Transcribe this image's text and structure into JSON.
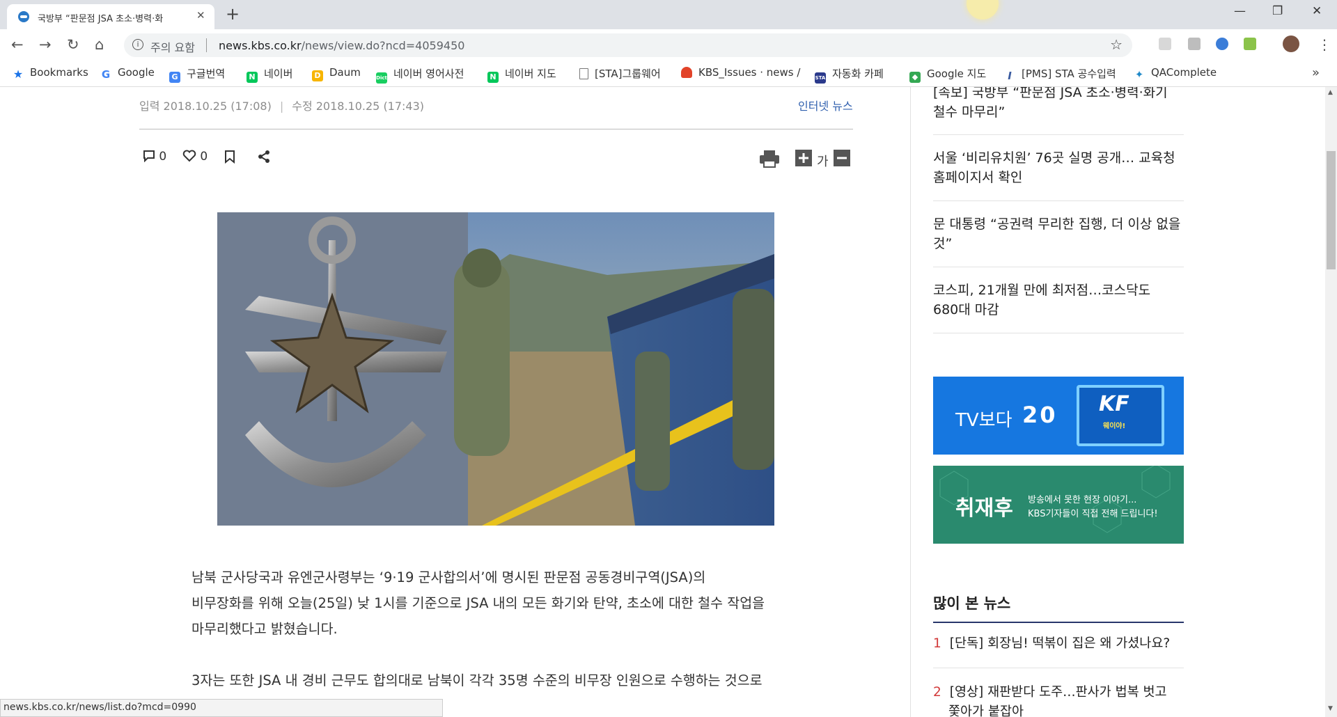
{
  "browser": {
    "tab_title": "국방부 “판문점 JSA 초소·병력·화",
    "new_tab": "+",
    "window_minimize": "—",
    "window_restore": "❐",
    "window_close": "✕",
    "security_warning": "주의 요함",
    "url_host": "news.kbs.co.kr",
    "url_path": "/news/view.do?ncd=4059450"
  },
  "bookmarks": [
    {
      "label": "Bookmarks",
      "icon": "star-icon",
      "color": "#1a73e8"
    },
    {
      "label": "Google",
      "icon": "google-icon",
      "color": "#4285f4"
    },
    {
      "label": "구글번역",
      "icon": "translate-icon",
      "color": "#4285f4"
    },
    {
      "label": "네이버",
      "icon": "naver-icon",
      "color": "#03c75a"
    },
    {
      "label": "Daum",
      "icon": "daum-icon",
      "color": "#f7b500"
    },
    {
      "label": "네이버 영어사전",
      "icon": "dict-icon",
      "color": "#19ce60"
    },
    {
      "label": "네이버 지도",
      "icon": "naver-icon",
      "color": "#03c75a"
    },
    {
      "label": "[STA]그룹웨어",
      "icon": "page-icon",
      "color": "#888888"
    },
    {
      "label": "KBS_Issues · news /",
      "icon": "gitlab-icon",
      "color": "#e24329"
    },
    {
      "label": "자동화 카페",
      "icon": "cafe-icon",
      "color": "#2b3a8c"
    },
    {
      "label": "Google 지도",
      "icon": "maps-icon",
      "color": "#34a853"
    },
    {
      "label": "[PMS] STA 공수입력",
      "icon": "pms-icon",
      "color": "#3a5ba0"
    },
    {
      "label": "QAComplete",
      "icon": "qa-icon",
      "color": "#1e88c8"
    }
  ],
  "bookmarks_more": "»",
  "article": {
    "date_input": "입력 2018.10.25 (17:08)",
    "meta_sep": "|",
    "date_edit": "수정 2018.10.25 (17:43)",
    "section": "인터넷 뉴스",
    "comment_count": "0",
    "like_count": "0",
    "font_label": "가",
    "paragraphs": [
      "남북 군사당국과 유엔군사령부는 ‘9·19 군사합의서’에 명시된 판문점 공동경비구역(JSA)의",
      "비무장화를 위해 오늘(25일) 낮 1시를 기준으로 JSA 내의 모든 화기와 탄약, 초소에 대한 철수 작업을",
      "마무리했다고 밝혔습니다.",
      "3자는 또한 JSA 내 경비 근무도 합의대로 남북이 각각 35명 수준의 비무장 인원으로 수행하는 것으로"
    ]
  },
  "sidebar": {
    "related": [
      {
        "line1": "[속보] 국방부 “판문점 JSA 초소·병력·화기",
        "line2": "철수 마무리”"
      },
      {
        "line1": "서울 ‘비리유치원’ 76곳 실명 공개… 교육청",
        "line2": "홈페이지서 확인"
      },
      {
        "line1": "문 대통령 “공권력 무리한 집행, 더 이상 없을",
        "line2": "것”"
      },
      {
        "line1": "코스피, 21개월 만에 최저점…코스닥도",
        "line2": "680대 마감"
      }
    ],
    "banner1": {
      "left_text": "TV보다",
      "mid_text": "20",
      "logo": "KF",
      "logo_sub": "웨이야!",
      "color": "#1677e0"
    },
    "banner2": {
      "title": "취재후",
      "sub1": "방송에서 못한 현장 이야기...",
      "sub2": "KBS기자들이 직접 전해 드립니다!",
      "color": "#2a8a6e"
    },
    "popular_title": "많이 본 뉴스",
    "popular": [
      {
        "num": "1",
        "line1": "[단독] 회장님! 떡볶이 집은 왜 가셨나요?",
        "line2": ""
      },
      {
        "num": "2",
        "line1": "[영상] 재판받다 도주…판사가 법복 벗고",
        "line2": "쫓아가 붙잡아"
      }
    ]
  },
  "status_url": "news.kbs.co.kr/news/list.do?mcd=0990"
}
